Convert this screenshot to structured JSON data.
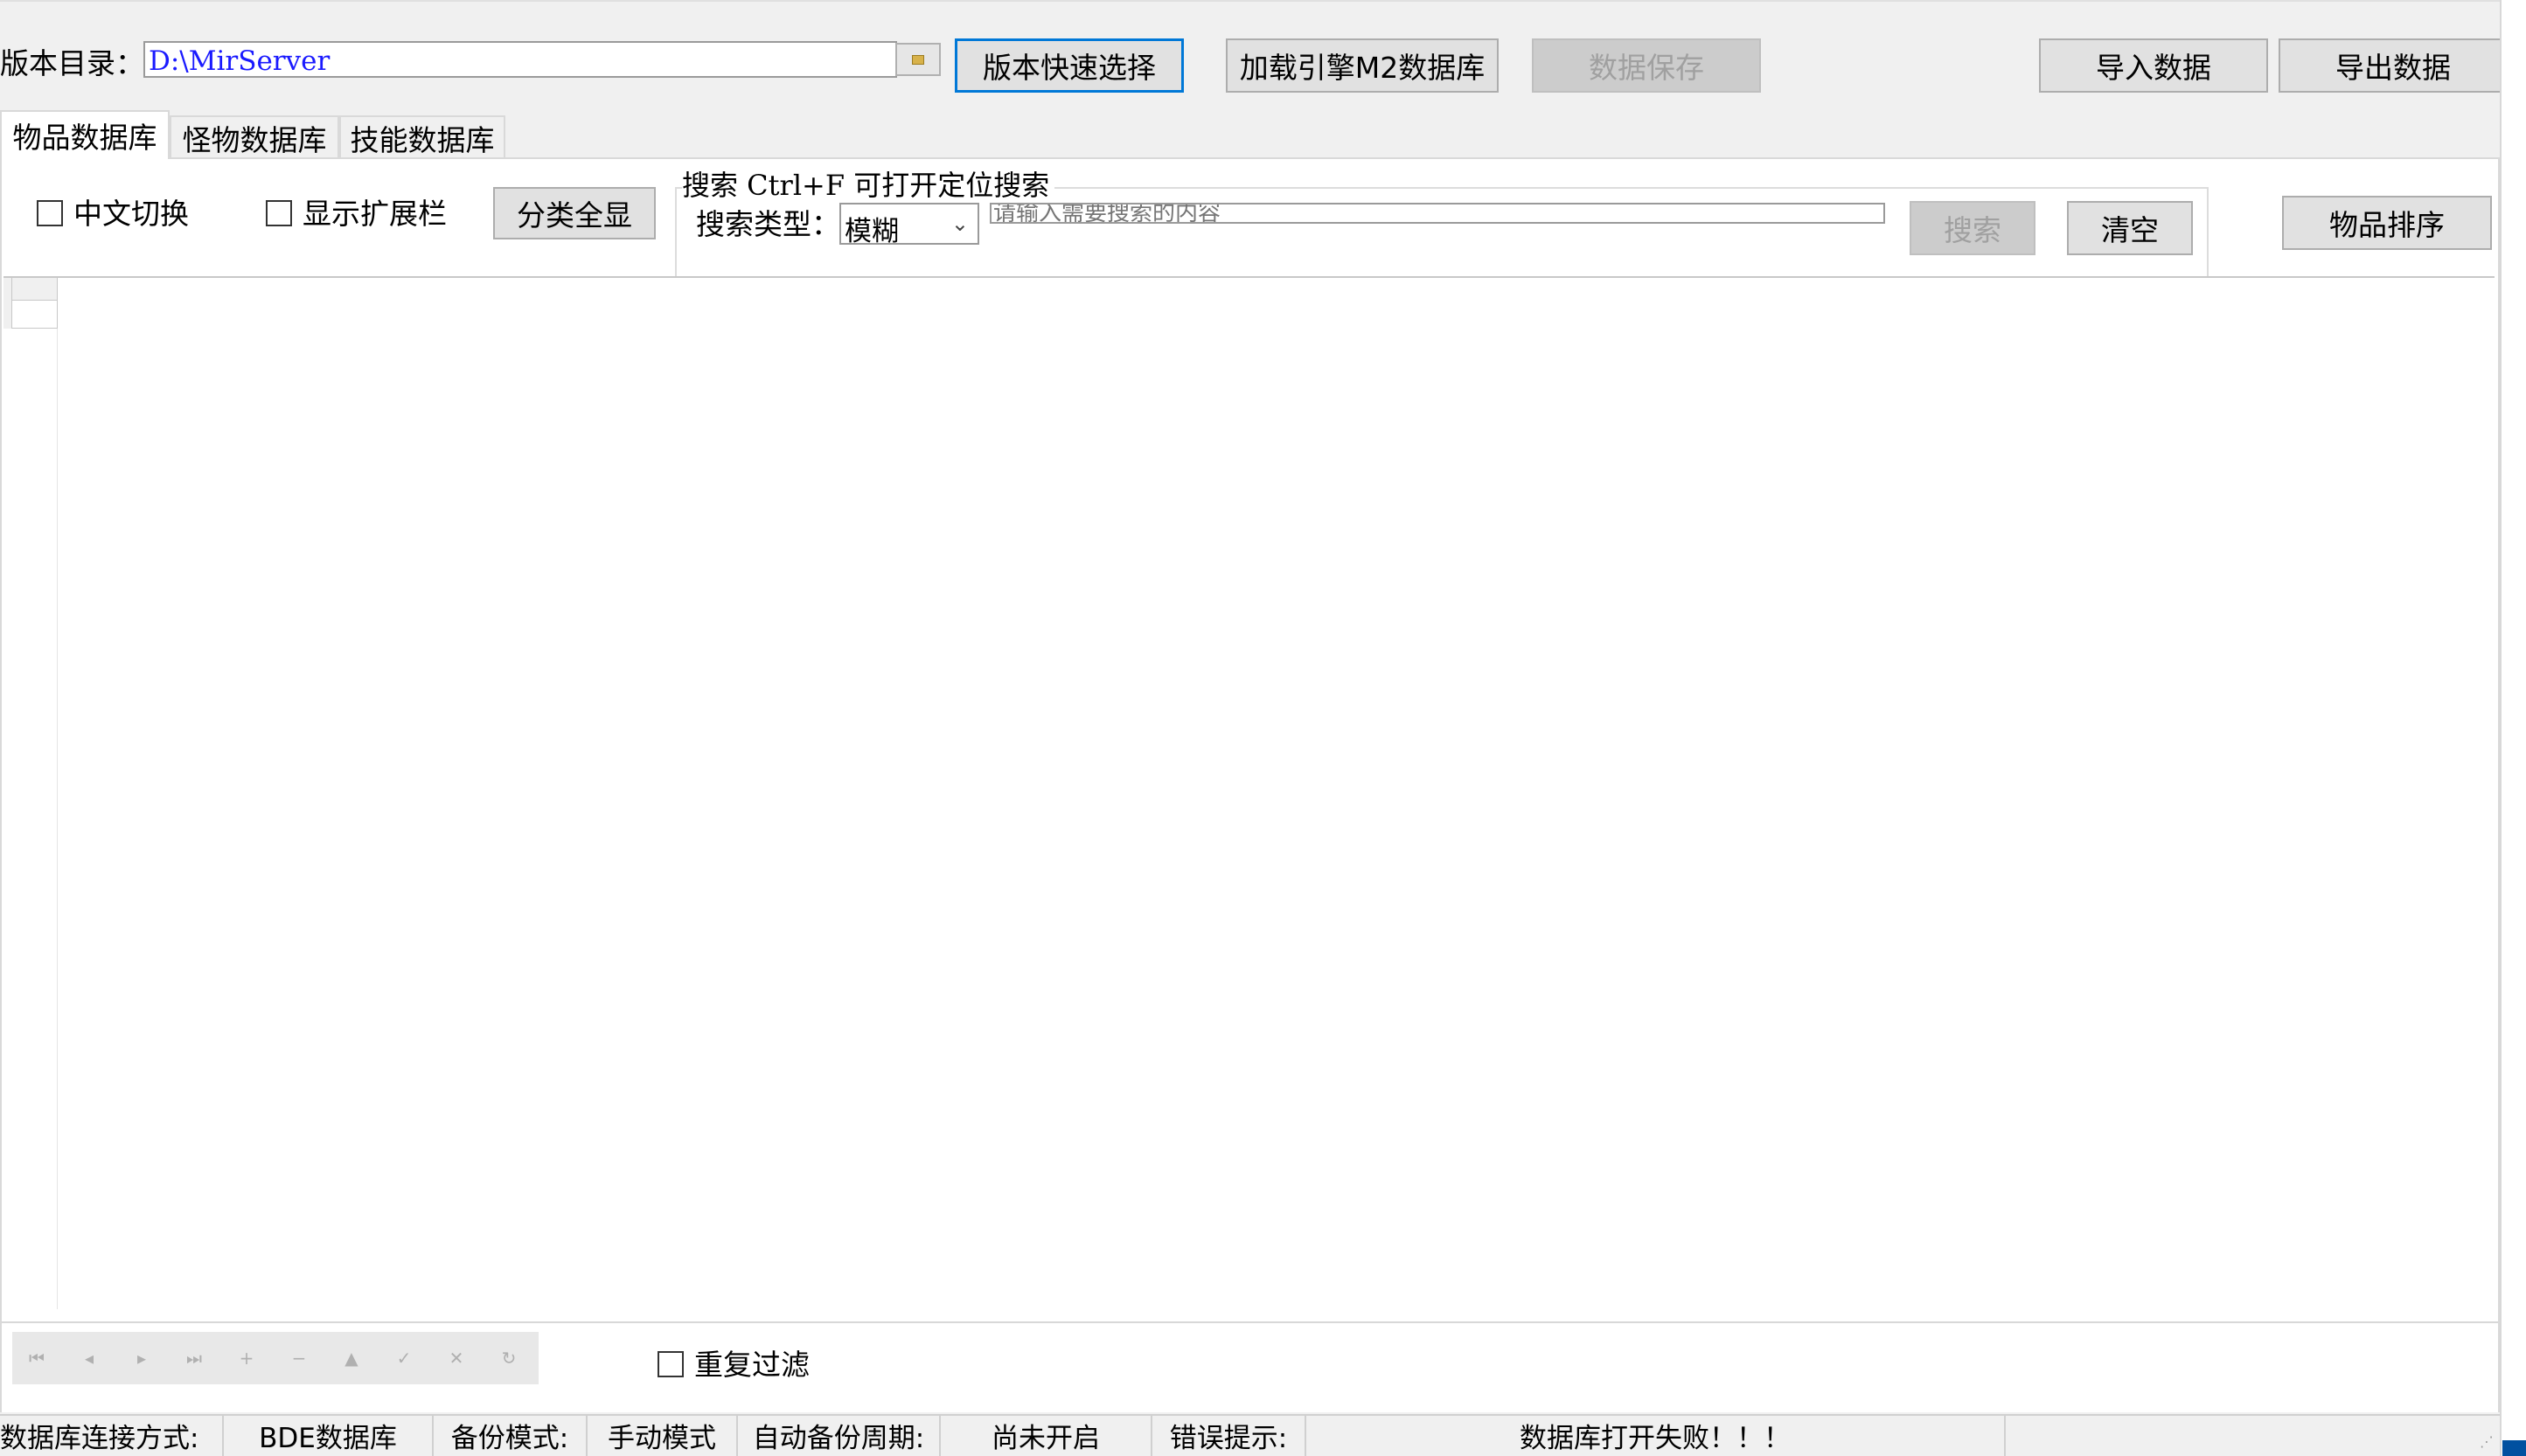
{
  "toolbar": {
    "dir_label": "版本目录：",
    "dir_value": "D:\\MirServer",
    "browse_icon": "folder-icon",
    "quick_select": "版本快速选择",
    "load_m2": "加载引擎M2数据库",
    "save_data": "数据保存",
    "import_data": "导入数据",
    "export_data": "导出数据"
  },
  "tabs": [
    {
      "label": "物品数据库",
      "active": true
    },
    {
      "label": "怪物数据库",
      "active": false
    },
    {
      "label": "技能数据库",
      "active": false
    }
  ],
  "options": {
    "chinese_switch": "中文切换",
    "show_extend": "显示扩展栏",
    "show_all_categories": "分类全显"
  },
  "search": {
    "group_title": "搜索  Ctrl+F 可打开定位搜索",
    "type_label": "搜索类型：",
    "type_value": "模糊",
    "placeholder": "请输入需要搜索的内容",
    "search_button": "搜索",
    "clear_button": "清空"
  },
  "sort_button": "物品排序",
  "navigator": {
    "buttons": [
      "first-icon",
      "prior-icon",
      "next-icon",
      "last-icon",
      "insert-icon",
      "delete-icon",
      "edit-icon",
      "post-icon",
      "cancel-icon",
      "refresh-icon"
    ],
    "glyphs": [
      "⏮",
      "◂",
      "▸",
      "⏭",
      "+",
      "−",
      "▲",
      "✓",
      "✕",
      "↻"
    ]
  },
  "duplicate_filter": "重复过滤",
  "statusbar": {
    "conn_label": "数据库连接方式:",
    "conn_value": "BDE数据库",
    "backup_label": "备份模式:",
    "backup_value": "手动模式",
    "auto_label": "自动备份周期:",
    "auto_value": "尚未开启",
    "error_label": "错误提示:",
    "error_value": "数据库打开失败！！！"
  },
  "colors": {
    "accent": "#0078d7",
    "window_bg": "#f0f0f0",
    "path_text": "#1a1aff"
  }
}
